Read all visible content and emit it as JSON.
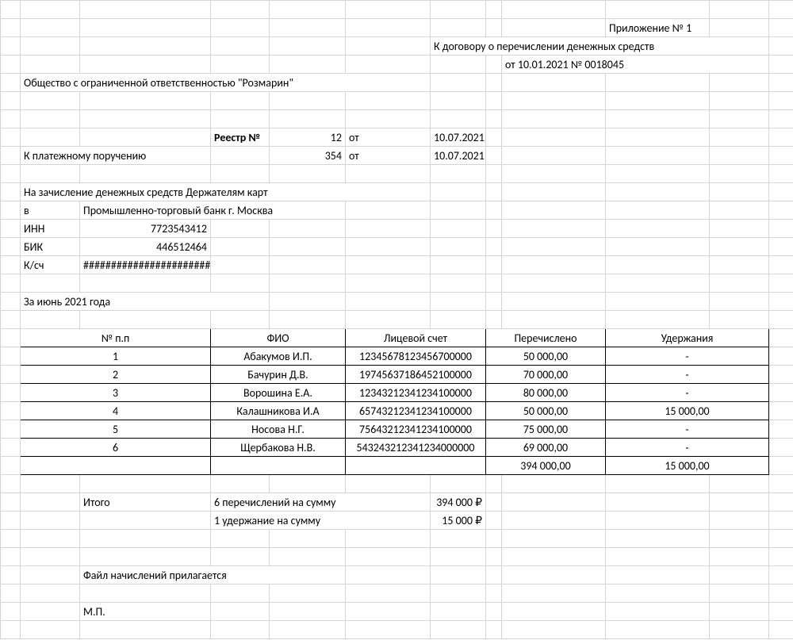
{
  "header": {
    "appendix": "Приложение № 1",
    "contract_line": "К договору о перечислении денежных средств",
    "contract_from": "от 10.01.2021 № 0018045",
    "company": "Общество с ограниченной ответственностью \"Розмарин\"",
    "registry_label": "Реестр №",
    "registry_no": "12",
    "registry_ot": "от",
    "registry_date": "10.07.2021",
    "payorder_label": "К платежному поручению",
    "payorder_no": "354",
    "payorder_ot": "от",
    "payorder_date": "10.07.2021",
    "credit_line": "На зачисление денежных средств Держателям карт",
    "bank_v": "в",
    "bank_name": "Промышленно-торговый банк г. Москва",
    "inn_label": "ИНН",
    "inn": "7723543412",
    "bik_label": "БИК",
    "bik": "446512464",
    "ksch_label": "К/сч",
    "ksch": "#######################",
    "period": "За июнь 2021 года"
  },
  "table": {
    "headers": {
      "npp": "№ п.п",
      "fio": "ФИО",
      "account": "Лицевой счет",
      "transferred": "Перечислено",
      "withheld": "Удержания"
    },
    "rows": [
      {
        "n": "1",
        "fio": "Абакумов И.П.",
        "acc": "12345678123456700000",
        "sum": "50 000,00",
        "hold": "-"
      },
      {
        "n": "2",
        "fio": "Бачурин Д.В.",
        "acc": "19745637186452100000",
        "sum": "70 000,00",
        "hold": "-"
      },
      {
        "n": "3",
        "fio": "Ворошина Е.А.",
        "acc": "12343212341234100000",
        "sum": "80 000,00",
        "hold": "-"
      },
      {
        "n": "4",
        "fio": "Калашникова И.А",
        "acc": "65743212341234100000",
        "sum": "50 000,00",
        "hold": "15 000,00"
      },
      {
        "n": "5",
        "fio": "Носова Н.Г.",
        "acc": "75643212341234100000",
        "sum": "75 000,00",
        "hold": "-"
      },
      {
        "n": "6",
        "fio": "Щербакова Н.В.",
        "acc": "543243212341234000000",
        "sum": "69 000,00",
        "hold": "-"
      }
    ],
    "totals": {
      "sum": "394 000,00",
      "hold": "15 000,00"
    }
  },
  "footer": {
    "itogo_label": "Итого",
    "transfers_text": "6 перечислений на сумму",
    "transfers_sum": "394 000 ₽",
    "holds_text": "1 удержание на сумму",
    "holds_sum": "15 000 ₽",
    "file_attached": "Файл начислений прилагается",
    "mp": "М.П."
  }
}
